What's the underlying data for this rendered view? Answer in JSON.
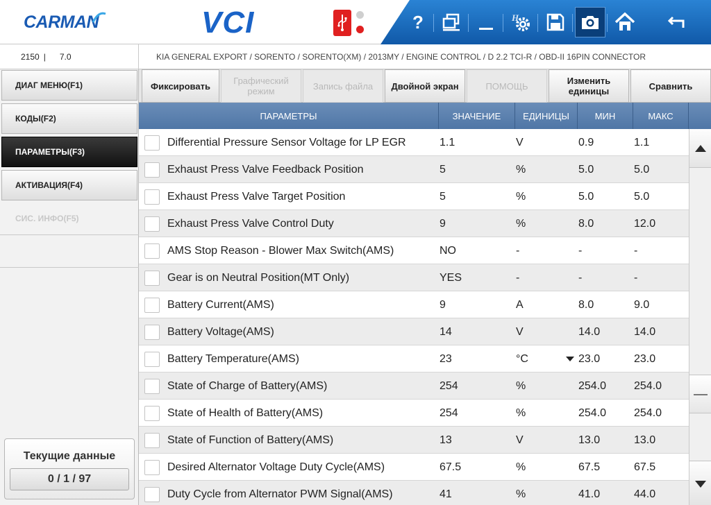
{
  "header": {
    "logo": "CARMAN",
    "product": "VCI",
    "toolbar": {
      "help_icon": "question-mark-icon",
      "window_icon": "window-icon",
      "minimize_icon": "minimize-icon",
      "settings_icon": "hardware-settings-icon",
      "save_icon": "floppy-disk-icon",
      "camera_icon": "camera-icon",
      "home_icon": "home-icon",
      "back_icon": "back-arrow-icon"
    },
    "colors": {
      "toolbar": "#1a6fc2",
      "usb": "#e02020",
      "logo": "#1a5bb3"
    }
  },
  "version": {
    "code": "2150",
    "separator": "|",
    "number": "7.0"
  },
  "breadcrumb": "KIA GENERAL EXPORT / SORENTO / SORENTO(XM) / 2013MY / ENGINE CONTROL / D 2.2 TCI-R / OBD-II 16PIN CONNECTOR",
  "sidebar": {
    "items": [
      {
        "label": "ДИАГ МЕНЮ(F1)",
        "state": "normal"
      },
      {
        "label": "КОДЫ(F2)",
        "state": "normal"
      },
      {
        "label": "ПАРАМЕТРЫ(F3)",
        "state": "active"
      },
      {
        "label": "АКТИВАЦИЯ(F4)",
        "state": "normal"
      },
      {
        "label": "СИС. ИНФО(F5)",
        "state": "disabled"
      }
    ],
    "current": {
      "title": "Текущие данные",
      "count": "0 / 1 / 97"
    }
  },
  "actions": {
    "fix": "Фиксировать",
    "graph": "Графический режим",
    "record": "Запись файла",
    "dual": "Двойной экран",
    "help": "ПОМОЩЬ",
    "units": "Изменить единицы",
    "compare": "Сравнить"
  },
  "table": {
    "headers": {
      "param": "ПАРАМЕТРЫ",
      "value": "ЗНАЧЕНИЕ",
      "unit": "ЕДИНИЦЫ",
      "min": "МИН",
      "max": "МАКС"
    },
    "rows": [
      {
        "name": "Differential Pressure Sensor Voltage for LP EGR",
        "value": "1.1",
        "unit": "V",
        "min": "0.9",
        "max": "1.1"
      },
      {
        "name": "Exhaust Press Valve Feedback Position",
        "value": "5",
        "unit": "%",
        "min": "5.0",
        "max": "5.0"
      },
      {
        "name": "Exhaust Press Valve Target Position",
        "value": "5",
        "unit": "%",
        "min": "5.0",
        "max": "5.0"
      },
      {
        "name": "Exhaust Press Valve Control Duty",
        "value": "9",
        "unit": "%",
        "min": "8.0",
        "max": "12.0"
      },
      {
        "name": "AMS Stop Reason - Blower Max Switch(AMS)",
        "value": "NO",
        "unit": "-",
        "min": "-",
        "max": "-"
      },
      {
        "name": "Gear is on Neutral Position(MT Only)",
        "value": "YES",
        "unit": "-",
        "min": "-",
        "max": "-"
      },
      {
        "name": "Battery Current(AMS)",
        "value": "9",
        "unit": "A",
        "min": "8.0",
        "max": "9.0"
      },
      {
        "name": "Battery Voltage(AMS)",
        "value": "14",
        "unit": "V",
        "min": "14.0",
        "max": "14.0"
      },
      {
        "name": "Battery Temperature(AMS)",
        "value": "23",
        "unit": "°C",
        "min": "23.0",
        "max": "23.0",
        "unit_dropdown": true
      },
      {
        "name": "State of Charge of Battery(AMS)",
        "value": "254",
        "unit": "%",
        "min": "254.0",
        "max": "254.0"
      },
      {
        "name": "State of Health of Battery(AMS)",
        "value": "254",
        "unit": "%",
        "min": "254.0",
        "max": "254.0"
      },
      {
        "name": "State of Function of Battery(AMS)",
        "value": "13",
        "unit": "V",
        "min": "13.0",
        "max": "13.0"
      },
      {
        "name": "Desired Alternator Voltage Duty Cycle(AMS)",
        "value": "67.5",
        "unit": "%",
        "min": "67.5",
        "max": "67.5"
      },
      {
        "name": "Duty Cycle from Alternator PWM Signal(AMS)",
        "value": "41",
        "unit": "%",
        "min": "41.0",
        "max": "44.0"
      }
    ]
  }
}
